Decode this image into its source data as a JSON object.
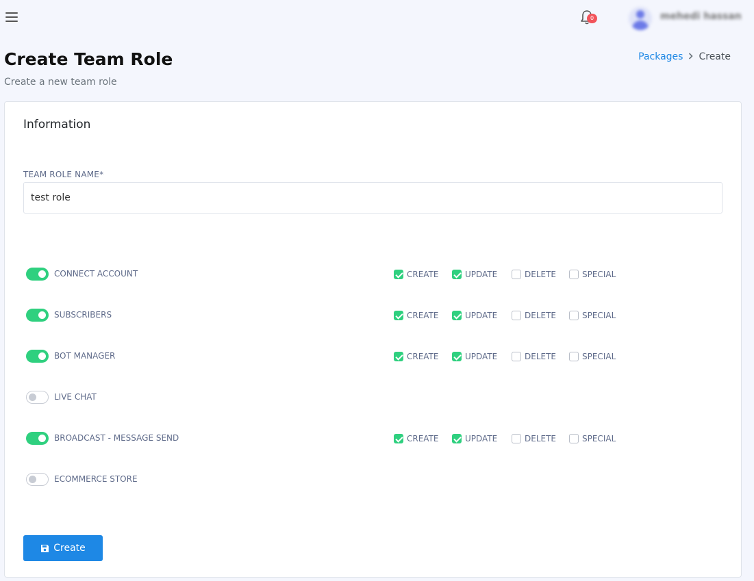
{
  "header": {
    "notification_count": "0",
    "user_name": "mehedi hassan"
  },
  "page": {
    "title": "Create Team Role",
    "subtitle": "Create a new team role"
  },
  "breadcrumb": {
    "parent": "Packages",
    "current": "Create"
  },
  "card": {
    "title": "Information",
    "role_name_label": "TEAM ROLE NAME*",
    "role_name_value": "test role"
  },
  "permission_labels": {
    "create": "CREATE",
    "update": "UPDATE",
    "delete": "DELETE",
    "special": "SPECIAL"
  },
  "permissions": [
    {
      "name": "CONNECT ACCOUNT",
      "enabled": true,
      "create": true,
      "update": true,
      "delete": false,
      "special": false
    },
    {
      "name": "SUBSCRIBERS",
      "enabled": true,
      "create": true,
      "update": true,
      "delete": false,
      "special": false
    },
    {
      "name": "BOT MANAGER",
      "enabled": true,
      "create": true,
      "update": true,
      "delete": false,
      "special": false
    },
    {
      "name": "LIVE CHAT",
      "enabled": false
    },
    {
      "name": "BROADCAST - MESSAGE SEND",
      "enabled": true,
      "create": true,
      "update": true,
      "delete": false,
      "special": false
    },
    {
      "name": "ECOMMERCE STORE",
      "enabled": false
    }
  ],
  "actions": {
    "create_label": "Create"
  },
  "colors": {
    "accent": "#1e88e5",
    "toggle_on": "#2fd07f",
    "badge": "#f2545b"
  }
}
